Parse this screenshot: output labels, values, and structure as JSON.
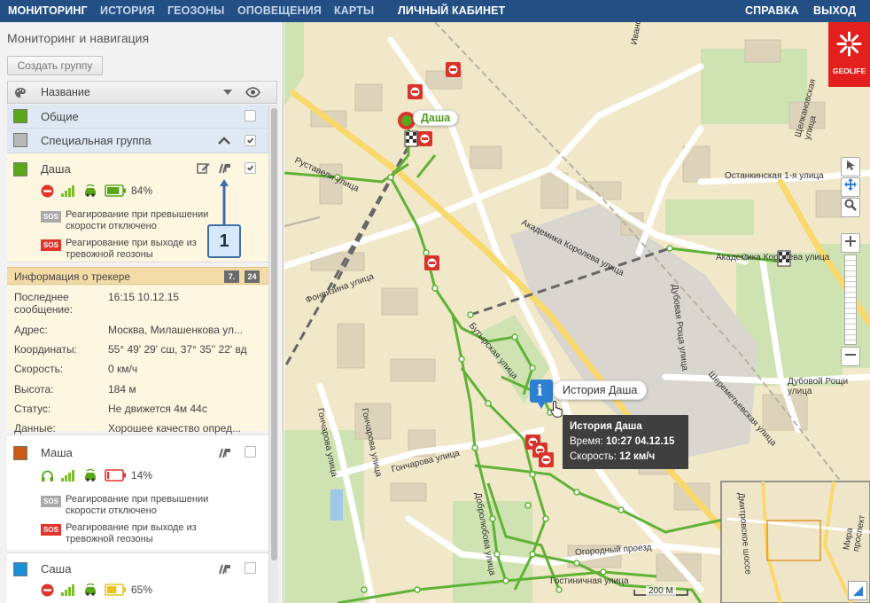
{
  "topnav": {
    "left": [
      "МОНИТОРИНГ",
      "ИСТОРИЯ",
      "ГЕОЗОНЫ",
      "ОПОВЕЩЕНИЯ",
      "КАРТЫ"
    ],
    "cabinet": "ЛИЧНЫЙ КАБИНЕТ",
    "help": "СПРАВКА",
    "logout": "ВЫХОД"
  },
  "sidebar": {
    "title": "Мониторинг и навигация",
    "create_group": "Создать группу",
    "col_name": "Название",
    "groups": [
      {
        "name": "Общие",
        "color": "#5aa81a"
      },
      {
        "name": "Специальная группа",
        "color": "#b8b8b8"
      }
    ],
    "trackers": [
      {
        "name": "Даша",
        "color": "#5aa81a",
        "battery": "84%",
        "battery_level": 0.84,
        "note1": "Реагирование при превышении скорости отключено",
        "note2": "Реагирование при выходе из тревожной геозоны",
        "sos": "SOS"
      },
      {
        "name": "Маша",
        "color": "#c75b13",
        "battery": "14%",
        "battery_level": 0.14,
        "note1": "Реагирование при превышении скорости отключено",
        "note2": "Реагирование при выходе из тревожной геозоны",
        "sos": "SOS"
      },
      {
        "name": "Саша",
        "color": "#1b8fd6",
        "battery": "65%",
        "battery_level": 0.65
      }
    ],
    "info": {
      "title": "Информация о трекере",
      "badge_a": "7.",
      "badge_b": "24",
      "rows": [
        {
          "k": "Последнее сообщение:",
          "v": "16:15 10.12.15"
        },
        {
          "k": "Адрес:",
          "v": "Москва, Милашенкова ул..."
        },
        {
          "k": "Координаты:",
          "v": "55° 49' 29' сш, 37° 35'' 22' вд"
        },
        {
          "k": "Скорость:",
          "v": "0 км/ч"
        },
        {
          "k": "Высота:",
          "v": "184 м"
        },
        {
          "k": "Статус:",
          "v": "Не движется 4м 44с"
        },
        {
          "k": "Данные:",
          "v": "Хорошее качество опред..."
        }
      ]
    },
    "annotation": "1"
  },
  "map": {
    "logo": "GEOLIFE",
    "marker_label": "Даша",
    "history_label": "История Даша",
    "tooltip": {
      "title": "История Даша",
      "time_k": "Время:",
      "time_v": "10:27 04.12.15",
      "speed_k": "Скорость:",
      "speed_v": "12 км/ч"
    },
    "scale": "200 М",
    "streets": [
      "Фонвизина улица",
      "Академика Королева улица",
      "Академика Королева улица",
      "Останкинская 1-я улица",
      "Гончарова улица",
      "Гончарова улица",
      "Дубовой Рощи улица",
      "Дубовая Роща улица",
      "Руставели улица",
      "Добролюбова улица",
      "Бутырская улица",
      "Огородный проезд",
      "Шереметьевская улица",
      "Дмитровское шоссе",
      "Мира проспект",
      "Ивановская улица",
      "Гостиничная улица",
      "Щелкановская улица",
      "Гончарова улица"
    ]
  }
}
